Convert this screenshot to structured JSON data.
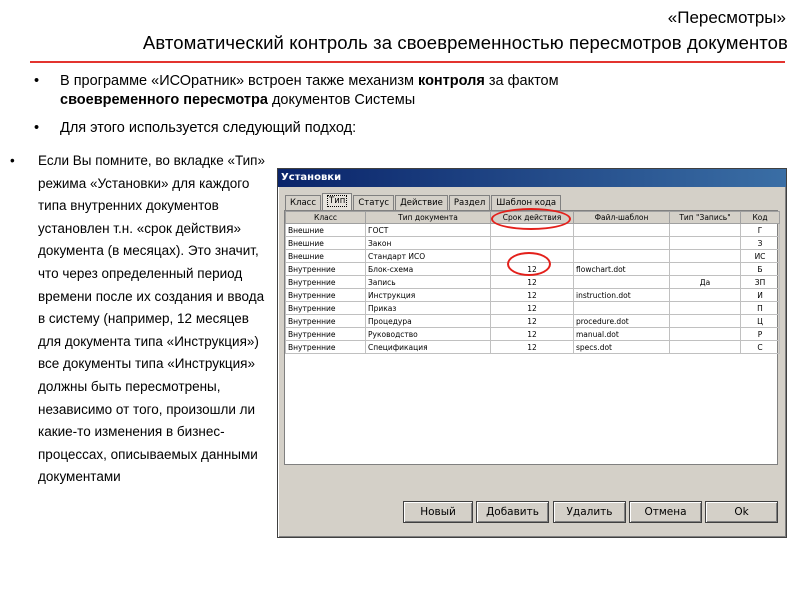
{
  "slide": {
    "subtitle": "«Пересмотры»",
    "title": "Автоматический контроль за своевременностью пересмотров документов"
  },
  "bullets": {
    "b1_pre": "В программе «ИСОратник» встроен также механизм ",
    "b1_bold1": "контроля",
    "b1_mid": " за фактом ",
    "b1_bold2": "своевременного пересмотра",
    "b1_post": " документов Системы",
    "b2": "Для этого используется следующий подход:",
    "marker": "•"
  },
  "left_text": "Если Вы помните, во вкладке «Тип» режима «Установки» для каждого типа внутренних документов установлен т.н. «срок действия» документа (в месяцах). Это значит, что через определенный период времени после их создания и ввода в систему (например, 12 месяцев для документа типа «Инструкция») все документы типа «Инструкция» должны быть пересмотрены, независимо от того, произошли ли какие-то изменения в бизнес-процессах, описываемых данными документами",
  "dialog": {
    "title": "Установки",
    "tabs": [
      "Класс",
      "Тип",
      "Статус",
      "Действие",
      "Раздел",
      "Шаблон кода"
    ],
    "active_tab": "Тип",
    "columns": [
      "Класс",
      "Тип документа",
      "Срок действия",
      "Файл-шаблон",
      "Тип \"Запись\"",
      "Код"
    ],
    "rows": [
      [
        "Внешние",
        "ГОСТ",
        "",
        "",
        "",
        "Г"
      ],
      [
        "Внешние",
        "Закон",
        "",
        "",
        "",
        "З"
      ],
      [
        "Внешние",
        "Стандарт ИСО",
        "",
        "",
        "",
        "ИС"
      ],
      [
        "Внутренние",
        "Блок-схема",
        "12",
        "flowchart.dot",
        "",
        "Б"
      ],
      [
        "Внутренние",
        "Запись",
        "12",
        "",
        "Да",
        "ЗП"
      ],
      [
        "Внутренние",
        "Инструкция",
        "12",
        "instruction.dot",
        "",
        "И"
      ],
      [
        "Внутренние",
        "Приказ",
        "12",
        "",
        "",
        "П"
      ],
      [
        "Внутренние",
        "Процедура",
        "12",
        "procedure.dot",
        "",
        "Ц"
      ],
      [
        "Внутренние",
        "Руководство",
        "12",
        "manual.dot",
        "",
        "Р"
      ],
      [
        "Внутренние",
        "Спецификация",
        "12",
        "specs.dot",
        "",
        "С"
      ]
    ],
    "buttons": {
      "new": "Новый",
      "add": "Добавить",
      "delete": "Удалить",
      "cancel": "Отмена",
      "ok": "Ok"
    }
  },
  "colors": {
    "accent": "#e3342f",
    "titlebar": "#0a246a",
    "window": "#d4d0c8"
  }
}
